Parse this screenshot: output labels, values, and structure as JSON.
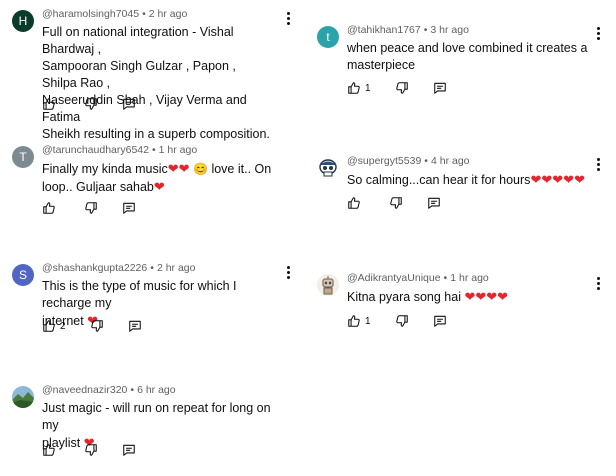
{
  "comments": [
    {
      "avatar_letter": "H",
      "avatar_color": "#0b3b2a",
      "username": "@haramolsingh7045",
      "time": "2 hr ago",
      "lines": [
        "Full on national integration - Vishal Bhardwaj ,",
        "Sampooran Singh Gulzar , Papon , Shilpa Rao ,",
        "Naseeruddin Shah , Vijay Verma and Fatima",
        "Sheikh resulting in a superb composition."
      ],
      "likes": ""
    },
    {
      "avatar_letter": "T",
      "avatar_color": "#7d8a92",
      "username": "@tarunchaudhary6542",
      "time": "1 hr ago",
      "line1": "Finally my kinda music",
      "line1_after": " love  it.. On",
      "line2": "loop..  Guljaar sahab",
      "likes": ""
    },
    {
      "avatar_letter": "S",
      "avatar_color": "#5166c2",
      "username": "@shashankgupta2226",
      "time": "2 hr ago",
      "lines": [
        "This is the type of music for which I recharge my",
        "internet "
      ],
      "likes": "2"
    },
    {
      "avatar_image": "landscape-photo",
      "username": "@naveednazir320",
      "time": "6 hr ago",
      "lines": [
        "Just magic - will run on repeat for long on my",
        "playlist "
      ],
      "likes": ""
    },
    {
      "avatar_letter": "t",
      "avatar_color": "#2aa3a9",
      "username": "@tahikhan1767",
      "time": "3 hr ago",
      "lines": [
        "when peace and love combined it creates a",
        "masterpiece"
      ],
      "likes": "1"
    },
    {
      "avatar_image": "skull-cartoon",
      "username": "@supergyt5539",
      "time": "4 hr ago",
      "lines": [
        "So calming...can hear it for hours"
      ],
      "likes": ""
    },
    {
      "avatar_image": "robot-cartoon",
      "username": "@AdikrantyaUnique",
      "time": "1 hr ago",
      "lines": [
        "Kitna pyara song hai "
      ],
      "likes": "1"
    }
  ],
  "separator": "•",
  "heart": "❤",
  "smile": "😊",
  "colors": {
    "text": "#0f0f0f",
    "meta": "#606060",
    "heart": "#e3262b"
  },
  "icons": [
    "like-icon",
    "dislike-icon",
    "reply-icon",
    "more-vert-icon"
  ]
}
